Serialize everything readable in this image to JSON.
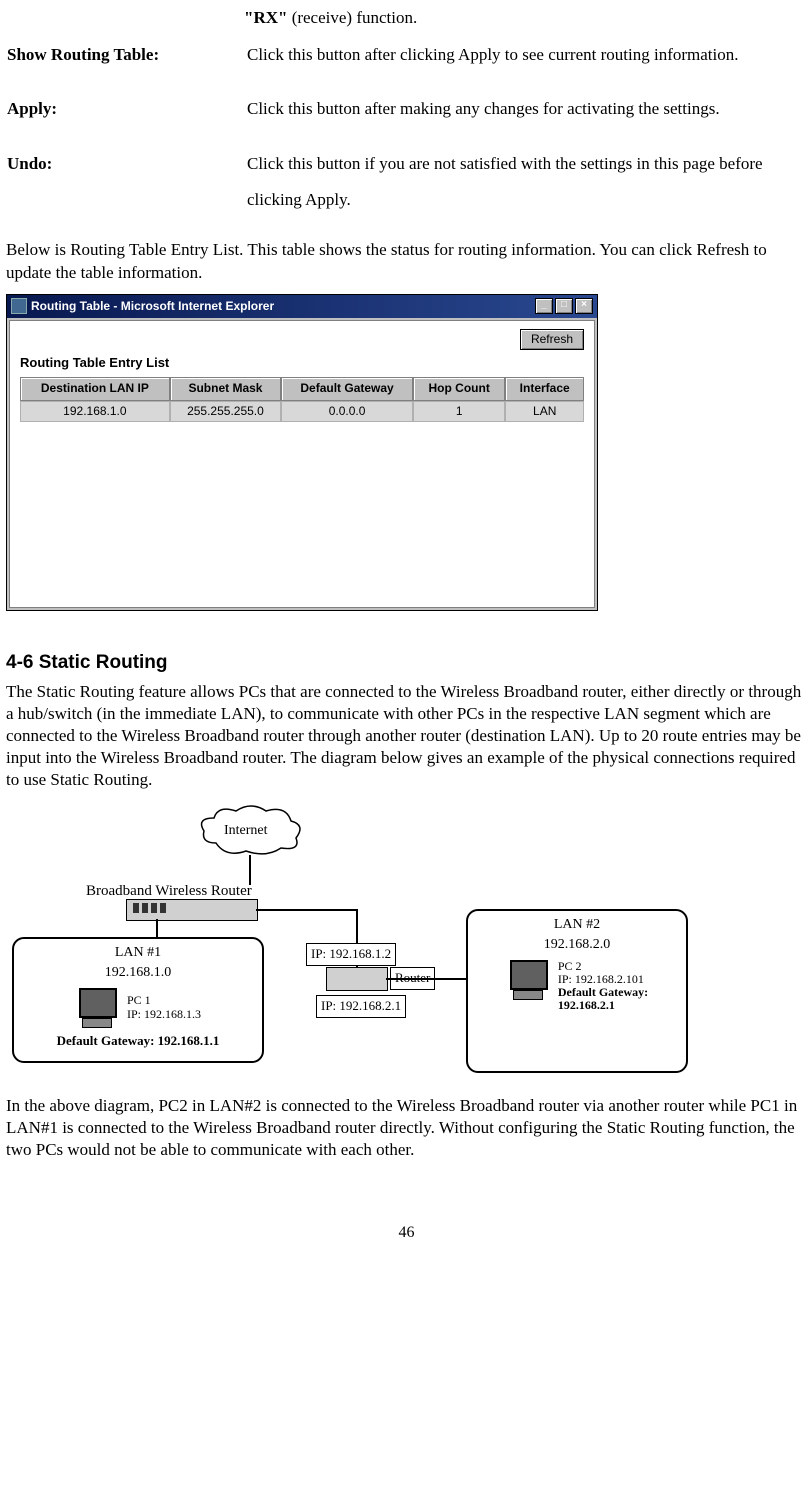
{
  "top_partial": {
    "rx": "\"RX\"",
    "rx_rest": " (receive) function."
  },
  "defs": [
    {
      "label": "Show Routing Table:",
      "text": "Click this button after clicking Apply to see current routing information."
    },
    {
      "label": "Apply:",
      "text": "Click this button after making any changes for activating the settings."
    },
    {
      "label": "Undo:",
      "text": "Click this button if you are not satisfied with the settings in this page before clicking Apply."
    }
  ],
  "below_text": "Below is Routing Table Entry List. This table shows the status for routing information. You can click Refresh to update the table information.",
  "window": {
    "title": "Routing Table - Microsoft Internet Explorer",
    "btns": {
      "min": "_",
      "max": "□",
      "close": "×"
    },
    "refresh": "Refresh",
    "list_title": "Routing Table Entry List",
    "headers": [
      "Destination LAN IP",
      "Subnet Mask",
      "Default Gateway",
      "Hop Count",
      "Interface"
    ],
    "row": [
      "192.168.1.0",
      "255.255.255.0",
      "0.0.0.0",
      "1",
      "LAN"
    ]
  },
  "section": {
    "heading": "4-6 Static Routing",
    "p1": "The Static Routing feature allows PCs that are connected to the Wireless Broadband router, either directly or through a hub/switch (in the immediate LAN), to communicate with other PCs in the respective LAN segment which are connected to the Wireless Broadband router through another router (destination LAN). Up to 20 route entries may be input into the Wireless Broadband router. The diagram below gives an example of the physical connections required to use Static Routing."
  },
  "diagram": {
    "internet": "Internet",
    "bwr_label": "Broadband Wireless Router",
    "lan1": {
      "title": "LAN #1",
      "net": "192.168.1.0",
      "pc": "PC 1",
      "pcip": "IP: 192.168.1.3",
      "gw": "Default Gateway: 192.168.1.1"
    },
    "router_label": "Router",
    "ip12": "IP: 192.168.1.2",
    "ip21": "IP: 192.168.2.1",
    "lan2": {
      "title": "LAN #2",
      "net": "192.168.2.0",
      "pc": "PC 2",
      "pcip": "IP: 192.168.2.101",
      "gw": "Default Gateway:",
      "gw2": "192.168.2.1"
    }
  },
  "p2": "In the above diagram, PC2 in LAN#2 is connected to the Wireless Broadband router via another router while PC1 in LAN#1 is connected to the Wireless Broadband router directly. Without configuring the Static Routing function, the two PCs would not be able to communicate with each other.",
  "page_number": "46"
}
